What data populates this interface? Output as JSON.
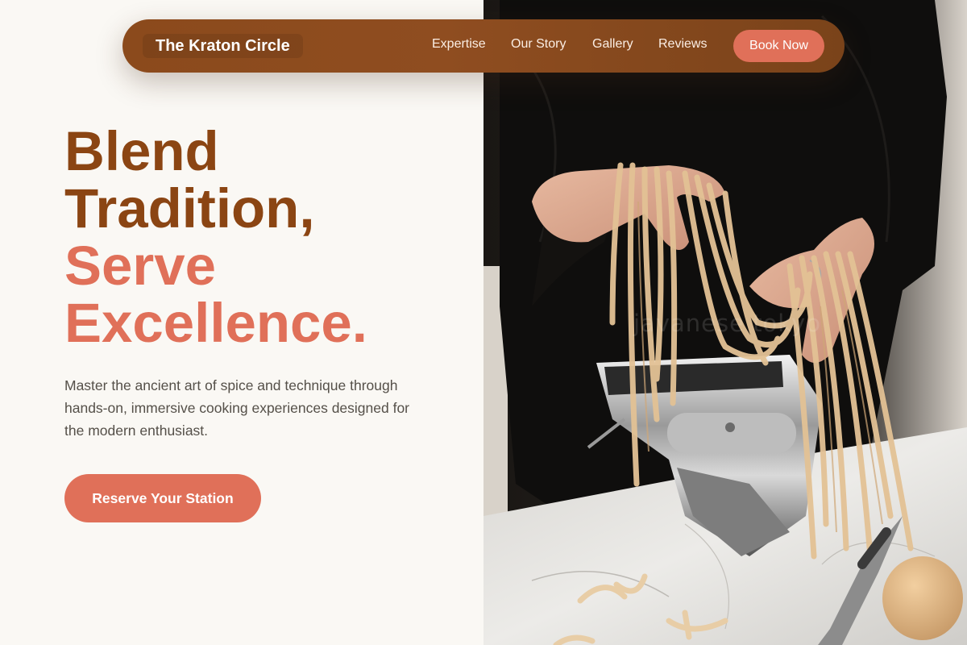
{
  "nav": {
    "brand": "The Kraton Circle",
    "links": [
      "Expertise",
      "Our Story",
      "Gallery",
      "Reviews"
    ],
    "cta_label": "Book Now"
  },
  "hero": {
    "headline_lines": [
      "Blend",
      "Tradition,",
      "Serve",
      "Excellence."
    ],
    "description": "Master the ancient art of spice and technique through hands-on, immersive cooking experiences designed for the modern enthusiast.",
    "cta_label": "Reserve Your Station"
  },
  "image": {
    "description": "Hands lifting fresh pasta ribbons from a pasta machine on a marble countertop",
    "watermark": "javanese tokyo"
  },
  "colors": {
    "background": "#faf8f4",
    "nav_bg": "#8b4a1c",
    "accent": "#e07059",
    "heading_brown": "#8b4513",
    "body_text": "#555049"
  }
}
